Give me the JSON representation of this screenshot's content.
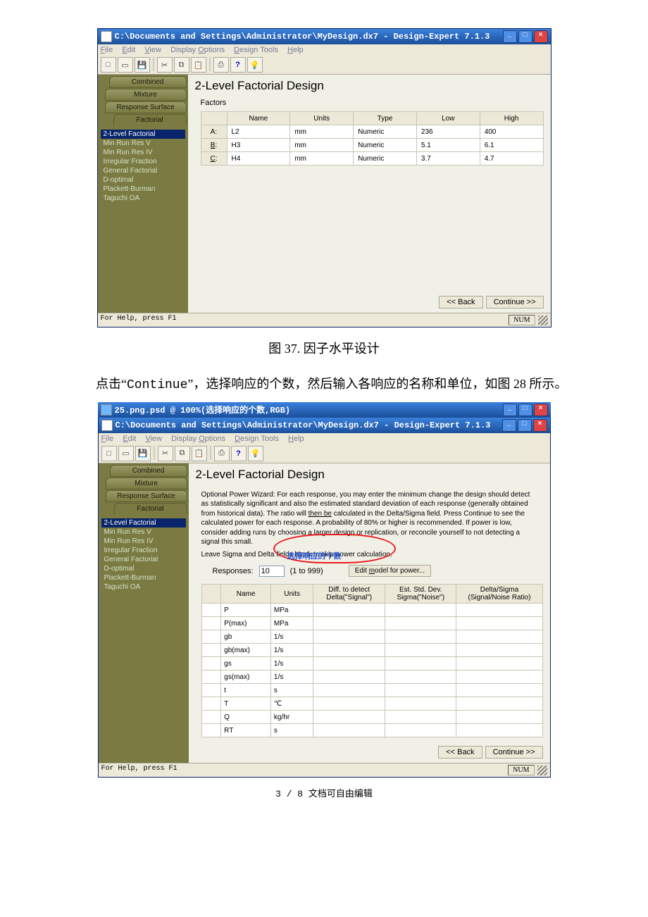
{
  "caption1": "图 37.  因子水平设计",
  "body_text": "点击\"Continue\"，选择响应的个数，然后输入各响应的名称和单位，如图 28 所示。",
  "footer": "3 / 8 文档可自由编辑",
  "win1": {
    "title": "C:\\Documents and Settings\\Administrator\\MyDesign.dx7 - Design-Expert 7.1.3",
    "menus": [
      "File",
      "Edit",
      "View",
      "Display Options",
      "Design Tools",
      "Help"
    ],
    "sidebar_tabs": [
      "Combined",
      "Mixture",
      "Response Surface",
      "Factorial"
    ],
    "sidebar_items": [
      "2-Level Factorial",
      "Min Run Res V",
      "Min Run Res IV",
      "Irregular Fraction",
      "General Factorial",
      "D-optimal",
      "Plackett-Burman",
      "Taguchi OA"
    ],
    "content_title": "2-Level Factorial Design",
    "subheading": "Factors",
    "table": {
      "headers": [
        "",
        "Name",
        "Units",
        "Type",
        "Low",
        "High"
      ],
      "rows": [
        {
          "label": "A:",
          "name": "L2",
          "units": "mm",
          "type": "Numeric",
          "low": "236",
          "high": "400"
        },
        {
          "label": "B:",
          "name": "H3",
          "units": "mm",
          "type": "Numeric",
          "low": "5.1",
          "high": "6.1"
        },
        {
          "label": "C:",
          "name": "H4",
          "units": "mm",
          "type": "Numeric",
          "low": "3.7",
          "high": "4.7"
        }
      ]
    },
    "back_btn": "<< Back",
    "continue_btn": "Continue >>",
    "status": "For Help, press F1",
    "status_right": "NUM"
  },
  "win2": {
    "outer_title": "25.png.psd @ 100%(选择响应的个数,RGB)",
    "title": "C:\\Documents and Settings\\Administrator\\MyDesign.dx7 - Design-Expert 7.1.3",
    "menus": [
      "File",
      "Edit",
      "View",
      "Display Options",
      "Design Tools",
      "Help"
    ],
    "sidebar_tabs": [
      "Combined",
      "Mixture",
      "Response Surface",
      "Factorial"
    ],
    "sidebar_items": [
      "2-Level Factorial",
      "Min Run Res V",
      "Min Run Res IV",
      "Irregular Fraction",
      "General Factorial",
      "D-optimal",
      "Plackett-Burman",
      "Taguchi OA"
    ],
    "content_title": "2-Level Factorial Design",
    "instructions": "Optional Power Wizard: For each response, you may enter the minimum change the design should detect as statistically significant and also the estimated standard deviation of each response (generally obtained from historical data). The ratio will then be calculated in the Delta/Sigma field. Press Continue to see the calculated power for each response. A probability of 80% or higher is recommended. If power is low, consider adding runs by choosing a larger design or replication, or reconcile yourself to not detecting a signal this small.",
    "leave_blank": "Leave Sigma and Delta fields blank to skip power calculation.",
    "responses_label": "Responses:",
    "responses_value": "10",
    "responses_range": "(1 to 999)",
    "edit_model_btn": "Edit model for power...",
    "annotation": "选择响应的个数",
    "resp_table": {
      "headers": [
        "Name",
        "Units",
        "Diff. to detect\nDelta(\"Signal\")",
        "Est. Std. Dev.\nSigma(\"Noise\")",
        "Delta/Sigma\n(Signal/Noise Ratio)"
      ],
      "rows": [
        {
          "name": "P",
          "units": "MPa"
        },
        {
          "name": "P(max)",
          "units": "MPa"
        },
        {
          "name": "gb",
          "units": "1/s"
        },
        {
          "name": "gb(max)",
          "units": "1/s"
        },
        {
          "name": "gs",
          "units": "1/s"
        },
        {
          "name": "gs(max)",
          "units": "1/s"
        },
        {
          "name": "t",
          "units": "s"
        },
        {
          "name": "T",
          "units": "℃"
        },
        {
          "name": "Q",
          "units": "kg/hr"
        },
        {
          "name": "RT",
          "units": "s"
        }
      ]
    },
    "back_btn": "<< Back",
    "continue_btn": "Continue >>",
    "status": "For Help, press F1",
    "status_right": "NUM"
  }
}
